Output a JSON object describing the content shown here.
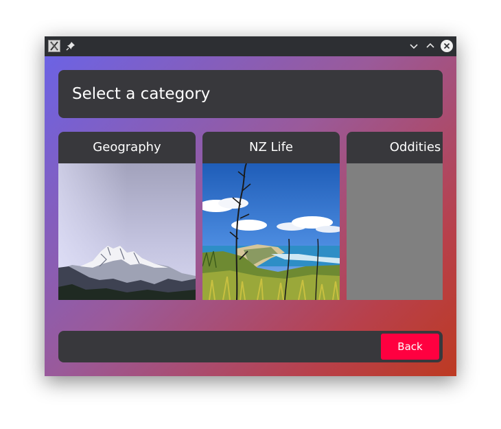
{
  "window": {
    "title": "",
    "controls": [
      "minimize-icon",
      "maximize-icon",
      "close-icon"
    ]
  },
  "header": {
    "title": "Select a category"
  },
  "categories": [
    {
      "label": "Geography",
      "image": "snowy-mountain-photo"
    },
    {
      "label": "NZ Life",
      "image": "coastal-flax-photo"
    },
    {
      "label": "Oddities",
      "image": "grey-placeholder"
    }
  ],
  "footer": {
    "back_label": "Back"
  },
  "colors": {
    "panel": "#38383c",
    "back_button": "#ff0040",
    "gradient_start": "#6c63e4",
    "gradient_end": "#bd3a22",
    "placeholder": "#808080"
  }
}
